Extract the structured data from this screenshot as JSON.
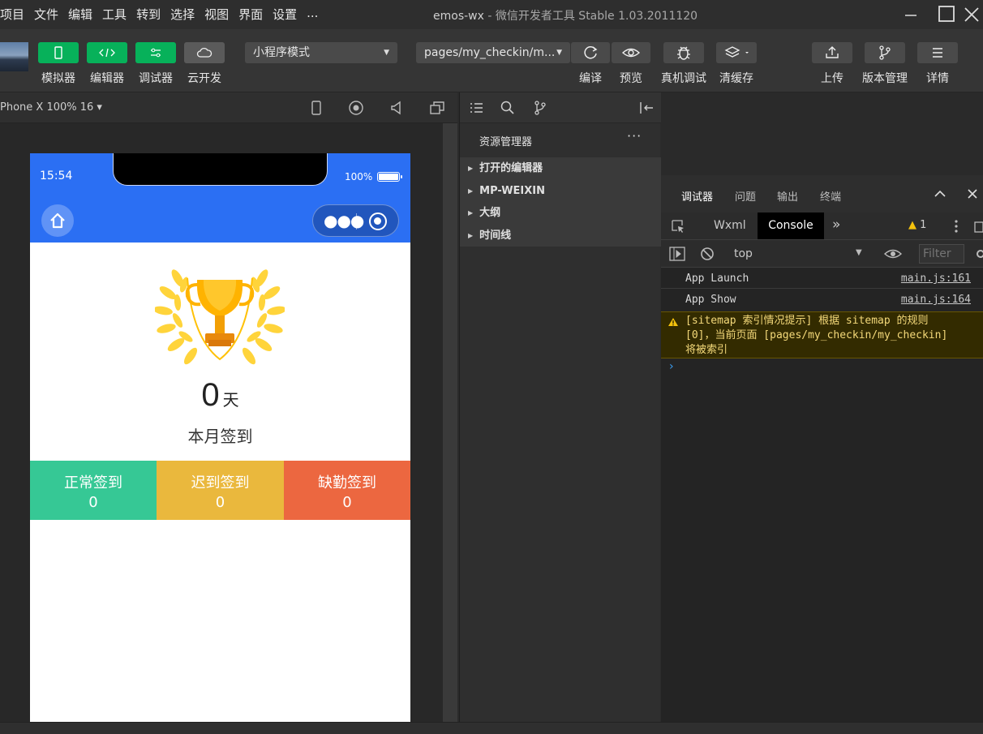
{
  "menubar": {
    "menus": [
      "项目",
      "文件",
      "编辑",
      "工具",
      "转到",
      "选择",
      "视图",
      "界面",
      "设置",
      "..."
    ],
    "app_name": "emos-wx",
    "title_suffix": " - 微信开发者工具 Stable 1.03.2011120"
  },
  "toolbar": {
    "simulator": "模拟器",
    "editor": "编辑器",
    "debugger": "调试器",
    "cloud": "云开发",
    "mode": "小程序模式",
    "page_path": "pages/my_checkin/m...",
    "compile": "编译",
    "preview": "预览",
    "remote_debug": "真机调试",
    "clear_cache": "清缓存",
    "upload": "上传",
    "version": "版本管理",
    "details": "详情"
  },
  "simulator": {
    "device": "Phone X 100% 16 ▾",
    "time": "15:54",
    "battery": "100%",
    "days_value": "0",
    "days_unit": "天",
    "month_label": "本月签到",
    "stats": [
      {
        "label": "正常签到",
        "value": "0",
        "color": "#36c895"
      },
      {
        "label": "迟到签到",
        "value": "0",
        "color": "#eab83d"
      },
      {
        "label": "缺勤签到",
        "value": "0",
        "color": "#ec6740"
      }
    ]
  },
  "explorer": {
    "title": "资源管理器",
    "more": "···",
    "items": [
      "打开的编辑器",
      "MP-WEIXIN",
      "大纲",
      "时间线"
    ]
  },
  "debug": {
    "tabs": [
      "调试器",
      "问题",
      "输出",
      "终端"
    ],
    "wxml_tab": "Wxml",
    "console_tab": "Console",
    "warn_count": "1",
    "context": "top",
    "filter_placeholder": "Filter",
    "logs": [
      {
        "msg": "App Launch",
        "src": "main.js:161"
      },
      {
        "msg": "App Show",
        "src": "main.js:164"
      }
    ],
    "warning": "[sitemap 索引情况提示] 根据 sitemap 的规则\n[0]，当前页面 [pages/my_checkin/my_checkin]\n将被索引",
    "prompt": "›"
  },
  "colors": {
    "accent_green": "#07b15a",
    "nav_blue": "#2b6ff3",
    "warning_bg": "#332b00"
  }
}
